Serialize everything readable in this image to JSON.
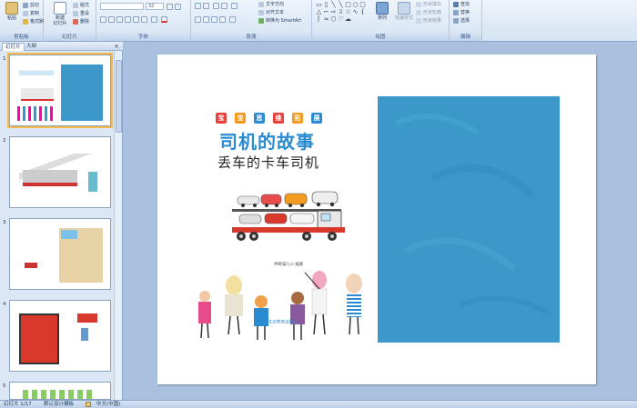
{
  "ribbon": {
    "clipboard": {
      "paste": "粘贴",
      "cut": "剪切",
      "copy": "复制",
      "format_painter": "格式刷",
      "label": "剪贴板"
    },
    "slides": {
      "new_slide": "新建\n幻灯片",
      "layout": "版式",
      "reset": "重设",
      "delete": "删除",
      "label": "幻灯片"
    },
    "font": {
      "size": "32",
      "label": "字体"
    },
    "paragraph": {
      "text_direction": "文字方向",
      "align_text": "对齐文本",
      "smartart": "转换为 SmartArt",
      "label": "段落"
    },
    "drawing": {
      "arrange": "排列",
      "quick_styles": "快速样式",
      "shape_fill": "形状填充",
      "shape_outline": "形状轮廓",
      "shape_effects": "形状效果",
      "label": "绘图"
    },
    "editing": {
      "find": "查找",
      "replace": "替换",
      "select": "选择",
      "label": "编辑"
    }
  },
  "left_panel": {
    "tabs": [
      "幻灯片",
      "大纲"
    ],
    "close": "×",
    "slide_numbers": [
      "1",
      "2",
      "3",
      "4",
      "5"
    ]
  },
  "slide": {
    "series_labels": [
      "宝",
      "宝",
      "思",
      "维",
      "拓",
      "展"
    ],
    "series_colors": [
      "#e8403c",
      "#f39b1f",
      "#2a8bd1",
      "#e8403c",
      "#f39b1f",
      "#2a8bd1"
    ],
    "title": "司机的故事",
    "subtitle": "丢车的卡车司机",
    "publisher": "神奇猫儿⊙ 编著",
    "press": "北京教育出版社",
    "blue_color": "#3b98c8"
  },
  "status": {
    "slide_count": "幻灯片 1/17",
    "theme": "默认设计模板",
    "language": "中文(中国)"
  }
}
